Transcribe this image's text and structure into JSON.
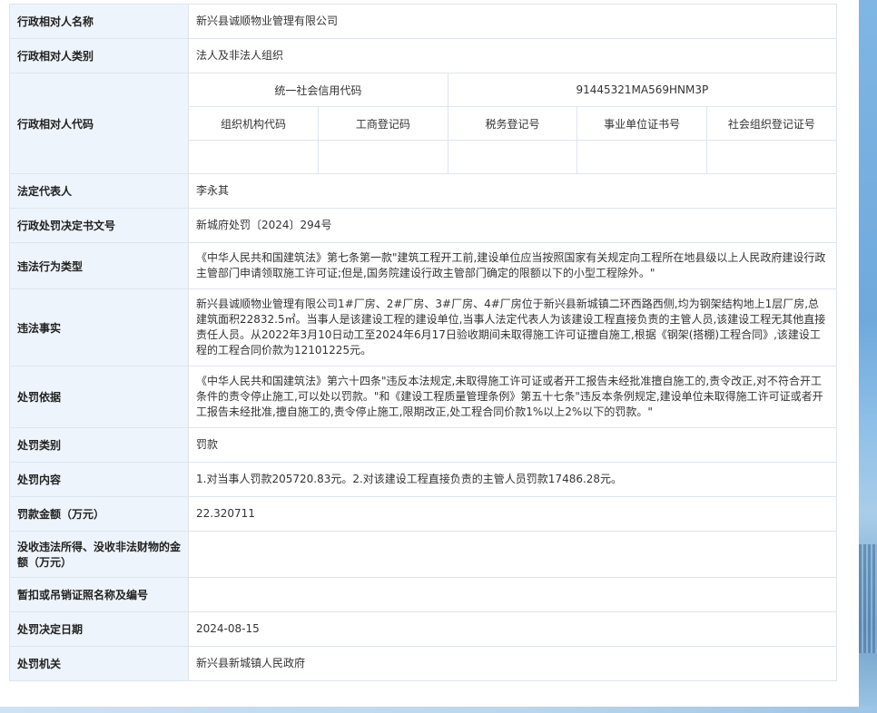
{
  "rows": {
    "name": {
      "label": "行政相对人名称",
      "value": "新兴县诚顺物业管理有限公司"
    },
    "category": {
      "label": "行政相对人类别",
      "value": "法人及非法人组织"
    },
    "code": {
      "label": "行政相对人代码",
      "credit_label": "统一社会信用代码",
      "credit_value": "91445321MA569HNM3P",
      "sub_headers": [
        "组织机构代码",
        "工商登记码",
        "税务登记号",
        "事业单位证书号",
        "社会组织登记证号"
      ],
      "sub_values": [
        "",
        "",
        "",
        "",
        ""
      ]
    },
    "legal_rep": {
      "label": "法定代表人",
      "value": "李永其"
    },
    "doc_no": {
      "label": "行政处罚决定书文号",
      "value": "新城府处罚〔2024〕294号"
    },
    "violation_type": {
      "label": "违法行为类型",
      "value": "《中华人民共和国建筑法》第七条第一款\"建筑工程开工前,建设单位应当按照国家有关规定向工程所在地县级以上人民政府建设行政主管部门申请领取施工许可证;但是,国务院建设行政主管部门确定的限额以下的小型工程除外。\""
    },
    "violation_facts": {
      "label": "违法事实",
      "value": "新兴县诚顺物业管理有限公司1#厂房、2#厂房、3#厂房、4#厂房位于新兴县新城镇二环西路西侧,均为钢架结构地上1层厂房,总建筑面积22832.5㎡。当事人是该建设工程的建设单位,当事人法定代表人为该建设工程直接负责的主管人员,该建设工程无其他直接责任人员。从2022年3月10日动工至2024年6月17日验收期间未取得施工许可证擅自施工,根据《钢架(搭棚)工程合同》,该建设工程的工程合同价款为12101225元。"
    },
    "basis": {
      "label": "处罚依据",
      "value": "《中华人民共和国建筑法》第六十四条\"违反本法规定,未取得施工许可证或者开工报告未经批准擅自施工的,责令改正,对不符合开工条件的责令停止施工,可以处以罚款。\"和《建设工程质量管理条例》第五十七条\"违反本条例规定,建设单位未取得施工许可证或者开工报告未经批准,擅自施工的,责令停止施工,限期改正,处工程合同价款1%以上2%以下的罚款。\""
    },
    "penalty_type": {
      "label": "处罚类别",
      "value": "罚款"
    },
    "penalty_content": {
      "label": "处罚内容",
      "value": "1.对当事人罚款205720.83元。2.对该建设工程直接负责的主管人员罚款17486.28元。"
    },
    "fine_amount": {
      "label": "罚款金额（万元）",
      "value": "22.320711"
    },
    "confiscation": {
      "label": "没收违法所得、没收非法财物的金额（万元）",
      "value": ""
    },
    "license": {
      "label": "暂扣或吊销证照名称及编号",
      "value": ""
    },
    "date": {
      "label": "处罚决定日期",
      "value": "2024-08-15"
    },
    "authority": {
      "label": "处罚机关",
      "value": "新兴县新城镇人民政府"
    }
  }
}
